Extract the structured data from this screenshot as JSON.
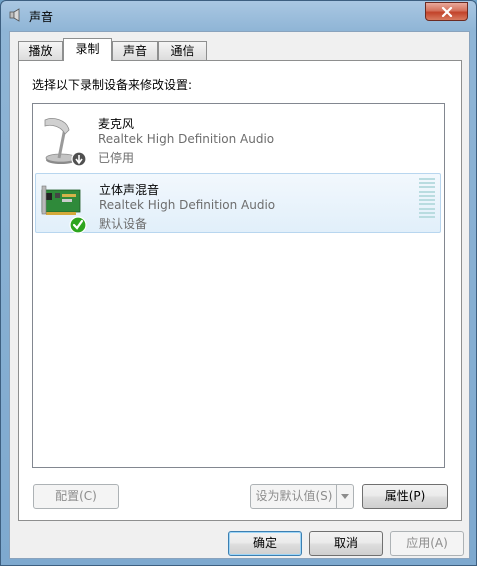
{
  "window": {
    "title": "声音"
  },
  "tabs": [
    {
      "label": "播放"
    },
    {
      "label": "录制"
    },
    {
      "label": "声音"
    },
    {
      "label": "通信"
    }
  ],
  "panel": {
    "prompt": "选择以下录制设备来修改设置:"
  },
  "devices": [
    {
      "name": "麦克风",
      "description": "Realtek High Definition Audio",
      "status": "已停用",
      "icon": "microphone-icon",
      "status_icon": "disabled-arrow-icon",
      "selected": false
    },
    {
      "name": "立体声混音",
      "description": "Realtek High Definition Audio",
      "status": "默认设备",
      "icon": "sound-card-icon",
      "status_icon": "default-check-icon",
      "selected": true,
      "level": 0
    }
  ],
  "panel_buttons": {
    "configure": "配置(C)",
    "set_default": "设为默认值(S)",
    "properties": "属性(P)"
  },
  "dialog_buttons": {
    "ok": "确定",
    "cancel": "取消",
    "apply": "应用(A)"
  },
  "colors": {
    "accent": "#3c7fb1",
    "check_green": "#2ea51e",
    "close_red": "#c2432a"
  }
}
